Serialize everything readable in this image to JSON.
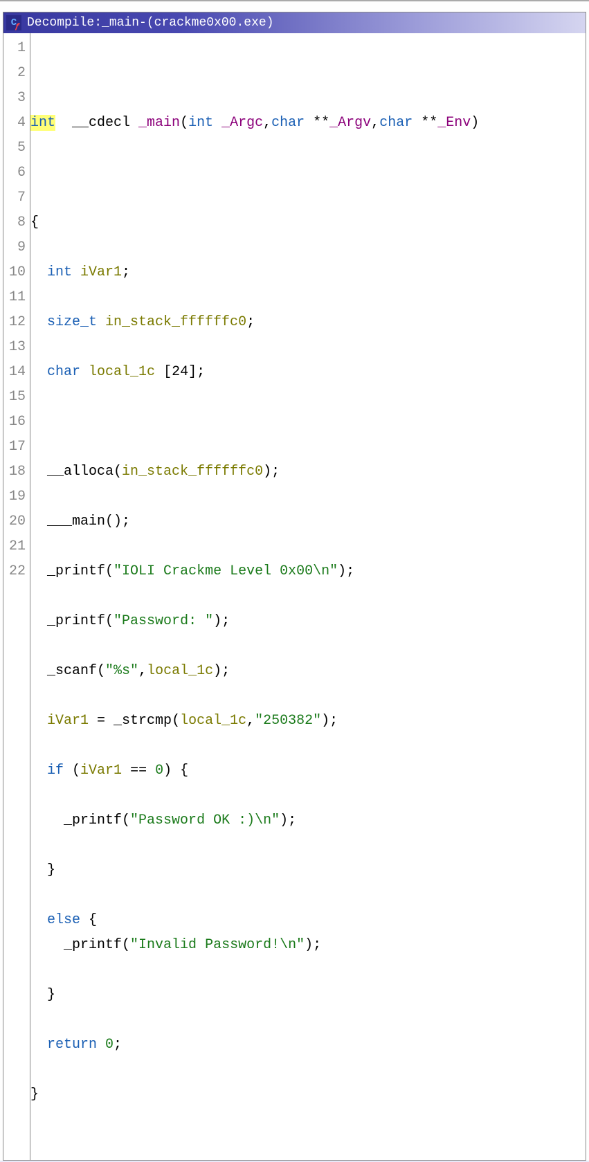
{
  "title": {
    "prefix": "Decompile: ",
    "func": "_main",
    "sep": " - ",
    "context": " (crackme0x00.exe)"
  },
  "line_numbers": [
    "1",
    "2",
    "3",
    "4",
    "5",
    "6",
    "7",
    "8",
    "9",
    "10",
    "11",
    "12",
    "13",
    "14",
    "15",
    "16",
    "17",
    "18",
    "19",
    "20",
    "21",
    "22"
  ],
  "code": {
    "l2": {
      "int": "int",
      "cdecl": "__cdecl ",
      "main": "_main",
      "open": "(",
      "int2": "int ",
      "argc": "_Argc",
      "comma1": ",",
      "char1": "char ",
      "stars1": "**",
      "argv": "_Argv",
      "comma2": ",",
      "char2": "char ",
      "stars2": "**",
      "env": "_Env",
      "close": ")"
    },
    "l4": {
      "brace": "{"
    },
    "l5": {
      "indent": "  ",
      "int": "int ",
      "var": "iVar1",
      "semi": ";"
    },
    "l6": {
      "indent": "  ",
      "type": "size_t ",
      "var": "in_stack_ffffffc0",
      "semi": ";"
    },
    "l7": {
      "indent": "  ",
      "type": "char ",
      "var": "local_1c ",
      "arr": "[24]",
      "semi": ";"
    },
    "l9": {
      "indent": "  ",
      "func": "__alloca",
      "open": "(",
      "arg": "in_stack_ffffffc0",
      "close": ")",
      "semi": ";"
    },
    "l10": {
      "indent": "  ",
      "func": "___main",
      "parens": "()",
      "semi": ";"
    },
    "l11": {
      "indent": "  ",
      "func": "_printf",
      "open": "(",
      "str": "\"IOLI Crackme Level 0x00\\n\"",
      "close": ")",
      "semi": ";"
    },
    "l12": {
      "indent": "  ",
      "func": "_printf",
      "open": "(",
      "str": "\"Password: \"",
      "close": ")",
      "semi": ";"
    },
    "l13": {
      "indent": "  ",
      "func": "_scanf",
      "open": "(",
      "str": "\"%s\"",
      "comma": ",",
      "arg": "local_1c",
      "close": ")",
      "semi": ";"
    },
    "l14": {
      "indent": "  ",
      "lhs": "iVar1 ",
      "eq": "= ",
      "func": "_strcmp",
      "open": "(",
      "arg1": "local_1c",
      "comma": ",",
      "str": "\"250382\"",
      "close": ")",
      "semi": ";"
    },
    "l15": {
      "indent": "  ",
      "if": "if ",
      "open": "(",
      "var": "iVar1 ",
      "op": "== ",
      "num": "0",
      "close": ") ",
      "brace": "{"
    },
    "l16": {
      "indent": "    ",
      "func": "_printf",
      "open": "(",
      "str": "\"Password OK :)\\n\"",
      "close": ")",
      "semi": ";"
    },
    "l17": {
      "indent": "  ",
      "brace": "}"
    },
    "l18": {
      "indent": "  ",
      "else": "else ",
      "brace": "{"
    },
    "l19": {
      "indent": "    ",
      "func": "_printf",
      "open": "(",
      "str": "\"Invalid Password!\\n\"",
      "close": ")",
      "semi": ";"
    },
    "l20": {
      "indent": "  ",
      "brace": "}"
    },
    "l21": {
      "indent": "  ",
      "return": "return ",
      "num": "0",
      "semi": ";"
    },
    "l22": {
      "brace": "}"
    }
  }
}
